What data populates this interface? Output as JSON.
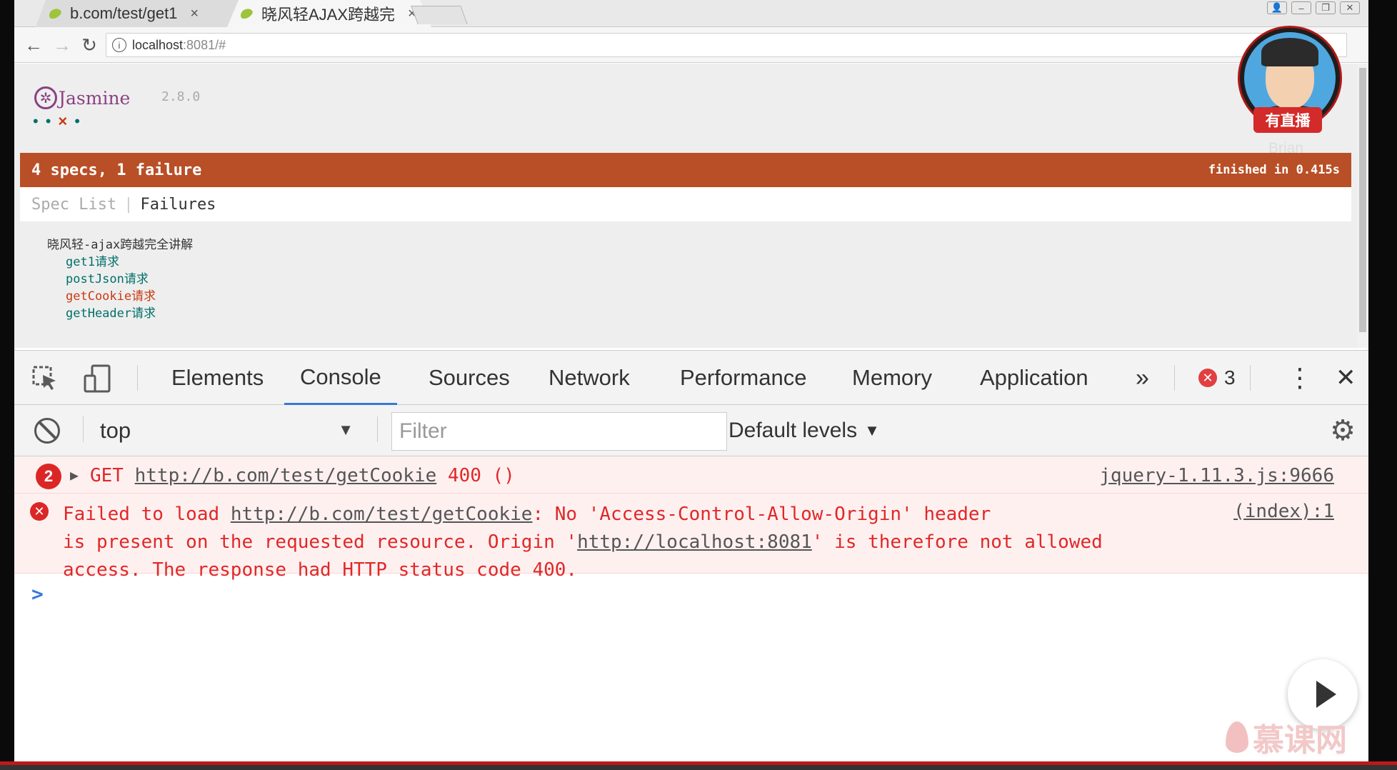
{
  "browser": {
    "tabs": [
      {
        "title": "b.com/test/get1",
        "close": "×"
      },
      {
        "title": "晓风轻AJAX跨越完",
        "close": "×"
      }
    ],
    "window_controls": [
      "👤",
      "–",
      "❐",
      "✕"
    ],
    "nav": {
      "back": "←",
      "forward": "→",
      "reload": "↻"
    },
    "url": {
      "host": "localhost",
      "rest": ":8081/#",
      "info": "i"
    }
  },
  "jasmine": {
    "logo_mark": "✲",
    "logo_text": "Jasmine",
    "version": "2.8.0",
    "dots": {
      "pass1": "•",
      "pass2": "•",
      "fail": "×",
      "pass3": "•"
    },
    "summary": "4 specs, 1 failure",
    "finished": "finished in 0.415s",
    "menu": {
      "spec_list": "Spec List",
      "separator": "|",
      "failures": "Failures"
    },
    "suite_title": "晓风轻-ajax跨越完全讲解",
    "specs": [
      {
        "name": "get1请求",
        "status": "passed"
      },
      {
        "name": "postJson请求",
        "status": "passed"
      },
      {
        "name": "getCookie请求",
        "status": "failed"
      },
      {
        "name": "getHeader请求",
        "status": "passed"
      }
    ]
  },
  "devtools": {
    "tabs": [
      "Elements",
      "Console",
      "Sources",
      "Network",
      "Performance",
      "Memory",
      "Application"
    ],
    "active_tab": "Console",
    "more": "»",
    "error_count": "3",
    "menu_icon": "⋮",
    "close_icon": "✕",
    "context": "top",
    "filter_placeholder": "Filter",
    "levels": "Default levels",
    "caret": "▼",
    "gear": "⚙"
  },
  "console": {
    "msg1": {
      "repeat": "2",
      "method": "GET ",
      "url": "http://b.com/test/getCookie",
      "status": " 400 ()",
      "source": "jquery-1.11.3.js:9666"
    },
    "msg2": {
      "prefix": "Failed to load ",
      "url": "http://b.com/test/getCookie",
      "mid": ": No 'Access-Control-Allow-Origin' header\nis present on the requested resource. Origin '",
      "origin": "http://localhost:8081",
      "suffix": "' is therefore not allowed\naccess. The response had HTTP status code 400.",
      "source": "(index):1"
    },
    "prompt": ">"
  },
  "overlay": {
    "live_badge": "有直播",
    "name": "Brian",
    "watermark": "慕课网"
  },
  "colors": {
    "jasmine_fail_bar": "#b84f26",
    "pass_green": "#007069",
    "fail_red": "#ca3a11",
    "console_error": "#e02828",
    "devtools_accent": "#3879d9"
  }
}
